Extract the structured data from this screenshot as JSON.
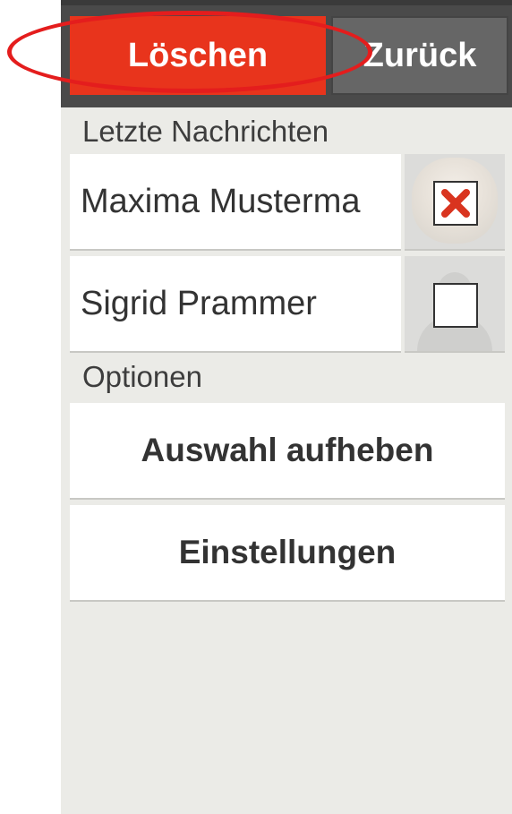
{
  "toolbar": {
    "delete_label": "Löschen",
    "back_label": "Zurück"
  },
  "sections": {
    "recent_label": "Letzte Nachrichten",
    "options_label": "Optionen"
  },
  "messages": [
    {
      "name": "Maxima Musterma",
      "checked": true,
      "avatar": "photo"
    },
    {
      "name": "Sigrid Prammer",
      "checked": false,
      "avatar": "placeholder-silhouette"
    }
  ],
  "options": [
    {
      "label": "Auswahl aufheben"
    },
    {
      "label": "Einstellungen"
    }
  ],
  "colors": {
    "delete": "#e8341c",
    "back": "#666666",
    "topbar": "#4a4a4a",
    "background": "#ebebe7",
    "highlight": "#e41d1d",
    "check_mark": "#d9341f"
  },
  "icons": {
    "checked": "x-mark-icon",
    "unchecked": "empty-checkbox-icon"
  }
}
